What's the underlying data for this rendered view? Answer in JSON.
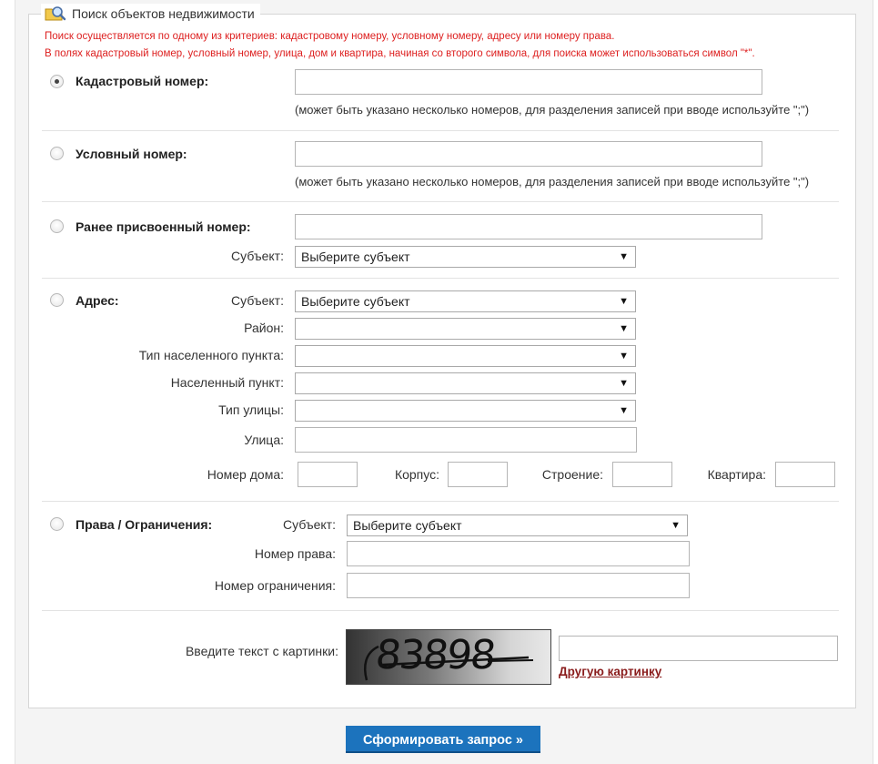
{
  "legend": {
    "title": "Поиск объектов недвижимости",
    "icon": "search-folder-icon"
  },
  "notes": [
    "Поиск осуществляется по одному из критериев: кадастровому номеру, условному номеру, адресу или номеру права.",
    "В полях кадастровый номер, условный номер, улица, дом и квартира, начиная со второго символа, для поиска может использоваться символ \"*\"."
  ],
  "cadastral": {
    "label": "Кадастровый номер:",
    "value": "",
    "hint": "(может быть указано несколько номеров, для разделения записей при вводе используйте \";\")"
  },
  "conditional": {
    "label": "Условный номер:",
    "value": "",
    "hint": "(может быть указано несколько номеров, для разделения записей при вводе используйте \";\")"
  },
  "previous": {
    "label": "Ранее присвоенный номер:",
    "value": "",
    "subject_label": "Субъект:",
    "subject_value": "Выберите субъект"
  },
  "address": {
    "label": "Адрес:",
    "subject_label": "Субъект:",
    "subject_value": "Выберите субъект",
    "district_label": "Район:",
    "district_value": "",
    "settlement_type_label": "Тип населенного пункта:",
    "settlement_type_value": "",
    "settlement_label": "Населенный пункт:",
    "settlement_value": "",
    "street_type_label": "Тип улицы:",
    "street_type_value": "",
    "street_label": "Улица:",
    "street_value": "",
    "house_label": "Номер дома:",
    "corpus_label": "Корпус:",
    "building_label": "Строение:",
    "apartment_label": "Квартира:"
  },
  "rights": {
    "label": "Права / Ограничения:",
    "subject_label": "Субъект:",
    "subject_value": "Выберите субъект",
    "right_number_label": "Номер права:",
    "restriction_number_label": "Номер ограничения:"
  },
  "captcha": {
    "label": "Введите текст с картинки:",
    "image_text": "83898",
    "another_link": "Другую картинку",
    "value": ""
  },
  "submit_label": "Сформировать запрос »",
  "selected_criterion": "cadastral"
}
